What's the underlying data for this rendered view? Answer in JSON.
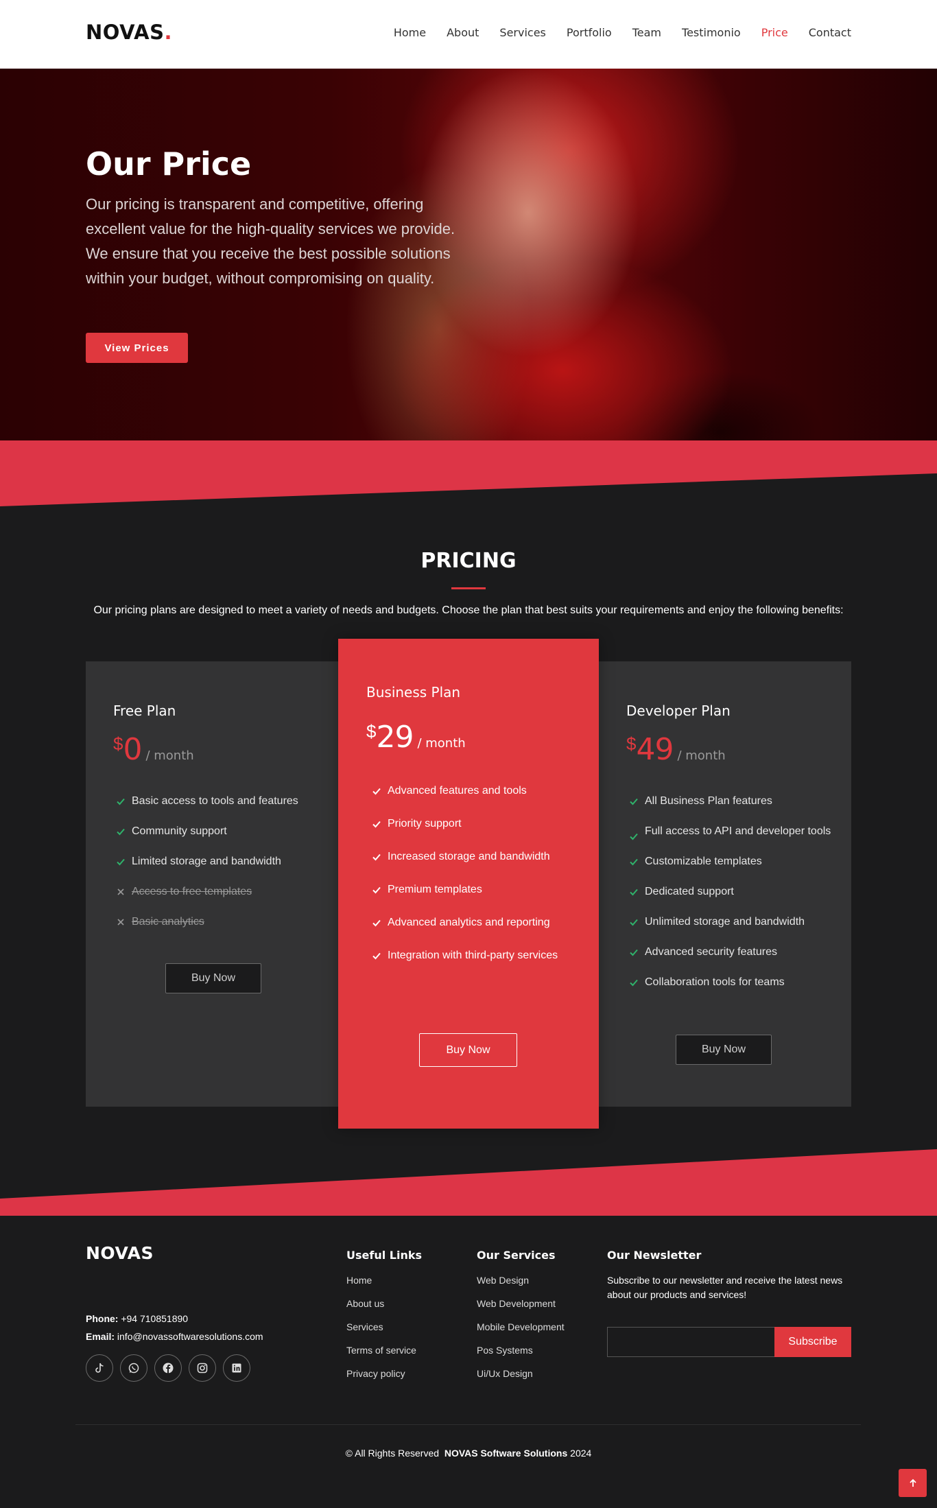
{
  "header": {
    "logo": "NOVAS",
    "logo_dot": ".",
    "nav": [
      {
        "label": "Home"
      },
      {
        "label": "About"
      },
      {
        "label": "Services"
      },
      {
        "label": "Portfolio"
      },
      {
        "label": "Team"
      },
      {
        "label": "Testimonio"
      },
      {
        "label": "Price",
        "active": true
      },
      {
        "label": "Contact"
      }
    ]
  },
  "hero": {
    "title": "Our Price",
    "text": "Our pricing is transparent and competitive, offering excellent value for the high-quality services we provide. We ensure that you receive the best possible solutions within your budget, without compromising on quality.",
    "button_label": "View Prices"
  },
  "pricing": {
    "title": "PRICING",
    "description": "Our pricing plans are designed to meet a variety of needs and budgets. Choose the plan that best suits your requirements and enjoy the following benefits:",
    "plans": [
      {
        "name": "Free Plan",
        "currency": "$",
        "amount": "0",
        "period": "/ month",
        "features": [
          {
            "text": "Basic access to tools and features",
            "included": true
          },
          {
            "text": "Community support",
            "included": true
          },
          {
            "text": "Limited storage and bandwidth",
            "included": true
          },
          {
            "text": "Access to free templates",
            "included": false
          },
          {
            "text": "Basic analytics",
            "included": false
          }
        ],
        "button_label": "Buy Now"
      },
      {
        "name": "Business Plan",
        "currency": "$",
        "amount": "29",
        "period": "/ month",
        "featured": true,
        "features": [
          {
            "text": "Advanced features and tools",
            "included": true
          },
          {
            "text": "Priority support",
            "included": true
          },
          {
            "text": "Increased storage and bandwidth",
            "included": true
          },
          {
            "text": "Premium templates",
            "included": true
          },
          {
            "text": "Advanced analytics and reporting",
            "included": true
          },
          {
            "text": "Integration with third-party services",
            "included": true
          }
        ],
        "button_label": "Buy Now"
      },
      {
        "name": "Developer Plan",
        "currency": "$",
        "amount": "49",
        "period": "/ month",
        "features": [
          {
            "text": "All Business Plan features",
            "included": true
          },
          {
            "text": "Full access to API and developer tools",
            "included": true
          },
          {
            "text": "Customizable templates",
            "included": true
          },
          {
            "text": "Dedicated support",
            "included": true
          },
          {
            "text": "Unlimited storage and bandwidth",
            "included": true
          },
          {
            "text": "Advanced security features",
            "included": true
          },
          {
            "text": "Collaboration tools for teams",
            "included": true
          }
        ],
        "button_label": "Buy Now"
      }
    ]
  },
  "footer": {
    "logo": "NOVAS",
    "phone_label": "Phone:",
    "phone": "+94 710851890",
    "email_label": "Email:",
    "email": "info@novassoftwaresolutions.com",
    "socials": [
      "tiktok-icon",
      "whatsapp-icon",
      "facebook-icon",
      "instagram-icon",
      "linkedin-icon"
    ],
    "useful_links": {
      "title": "Useful Links",
      "items": [
        "Home",
        "About us",
        "Services",
        "Terms of service",
        "Privacy policy"
      ]
    },
    "services": {
      "title": "Our Services",
      "items": [
        "Web Design",
        "Web Development",
        "Mobile Development",
        "Pos Systems",
        "Ui/Ux Design"
      ]
    },
    "newsletter": {
      "title": "Our Newsletter",
      "text": "Subscribe to our newsletter and receive the latest news about our products and services!",
      "input_value": "",
      "button_label": "Subscribe"
    },
    "copyright_prefix": "© All Rights Reserved",
    "copyright_company": "NOVAS Software Solutions",
    "copyright_year": "2024"
  },
  "colors": {
    "accent": "#e0383e",
    "background": "#1b1b1c",
    "card": "#333334",
    "check": "#2fb36b"
  }
}
